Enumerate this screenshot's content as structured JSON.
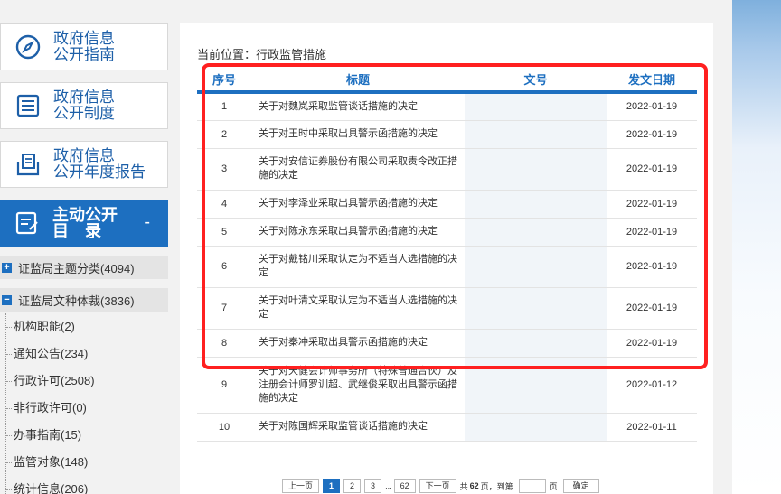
{
  "sidebar": {
    "boxes": [
      {
        "label": "政府信息\n公开指南",
        "icon": "compass-icon"
      },
      {
        "label": "政府信息\n公开制度",
        "icon": "list-doc-icon"
      },
      {
        "label": "政府信息\n公开年度报告",
        "icon": "folder-doc-icon"
      }
    ],
    "catalog": {
      "label": "主动公开\n目　录",
      "icon": "edit-doc-icon",
      "toggle": "-"
    },
    "categories": [
      {
        "label": "证监局主题分类(4094)",
        "toggle": "+"
      },
      {
        "label": "证监局文种体裁(3836)",
        "toggle": "−"
      }
    ],
    "tree_items": [
      "机构职能(2)",
      "通知公告(234)",
      "行政许可(2508)",
      "非行政许可(0)",
      "办事指南(15)",
      "监管对象(148)",
      "统计信息(206)"
    ]
  },
  "main": {
    "breadcrumb": "当前位置：行政监管措施",
    "columns": [
      "序号",
      "标题",
      "文号",
      "发文日期"
    ],
    "rows": [
      {
        "num": "1",
        "title": "关于对魏岚采取监管谈话措施的决定",
        "doc": "",
        "date": "2022-01-19"
      },
      {
        "num": "2",
        "title": "关于对王时中采取出具警示函措施的决定",
        "doc": "",
        "date": "2022-01-19"
      },
      {
        "num": "3",
        "title": "关于对安信证券股份有限公司采取责令改正措施的决定",
        "doc": "",
        "date": "2022-01-19"
      },
      {
        "num": "4",
        "title": "关于对李泽业采取出具警示函措施的决定",
        "doc": "",
        "date": "2022-01-19"
      },
      {
        "num": "5",
        "title": "关于对陈永东采取出具警示函措施的决定",
        "doc": "",
        "date": "2022-01-19"
      },
      {
        "num": "6",
        "title": "关于对戴铭川采取认定为不适当人选措施的决定",
        "doc": "",
        "date": "2022-01-19"
      },
      {
        "num": "7",
        "title": "关于对叶清文采取认定为不适当人选措施的决定",
        "doc": "",
        "date": "2022-01-19"
      },
      {
        "num": "8",
        "title": "关于对秦冲采取出具警示函措施的决定",
        "doc": "",
        "date": "2022-01-19"
      },
      {
        "num": "9",
        "title": "关于对天健会计师事务所（特殊普通合伙）及注册会计师罗训超、武继俊采取出具警示函措施的决定",
        "doc": "",
        "date": "2022-01-12"
      },
      {
        "num": "10",
        "title": "关于对陈国辉采取监管谈话措施的决定",
        "doc": "",
        "date": "2022-01-11"
      }
    ]
  },
  "pager": {
    "prev": "上一页",
    "pages": [
      "1",
      "2",
      "3"
    ],
    "ellipsis": "...",
    "last": "62",
    "next": "下一页",
    "total_prefix": "共",
    "total": "62",
    "total_suffix": "页，到第",
    "goto_suffix": "页",
    "confirm": "确定"
  },
  "colors": {
    "accent": "#1d6fc0",
    "highlight": "#ff2020"
  }
}
